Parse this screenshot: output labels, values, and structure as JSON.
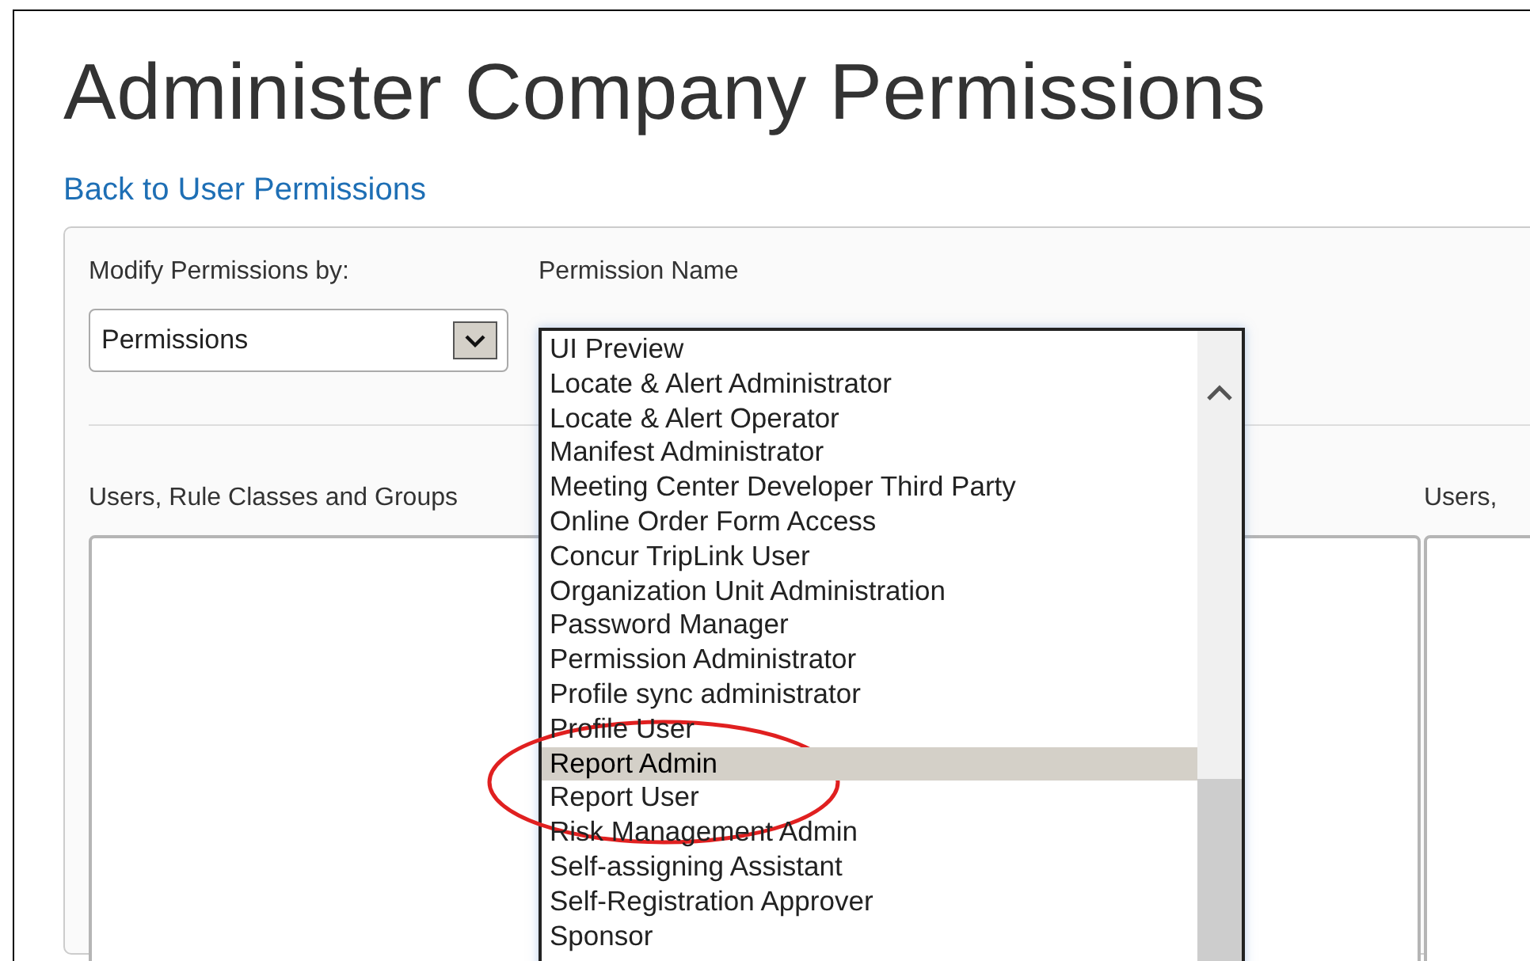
{
  "title": "Administer Company Permissions",
  "back_link": "Back to User Permissions",
  "filter": {
    "label": "Modify Permissions by:",
    "value": "Permissions"
  },
  "permission_name": {
    "label": "Permission Name",
    "options": [
      {
        "label": "UI Preview",
        "selected": false
      },
      {
        "label": "Locate & Alert Administrator",
        "selected": false
      },
      {
        "label": "Locate & Alert Operator",
        "selected": false
      },
      {
        "label": "Manifest Administrator",
        "selected": false
      },
      {
        "label": "Meeting Center Developer Third Party",
        "selected": false
      },
      {
        "label": "Online Order Form Access",
        "selected": false
      },
      {
        "label": "Concur TripLink User",
        "selected": false
      },
      {
        "label": "Organization Unit Administration",
        "selected": false
      },
      {
        "label": "Password Manager",
        "selected": false
      },
      {
        "label": "Permission Administrator",
        "selected": false
      },
      {
        "label": "Profile sync administrator",
        "selected": false
      },
      {
        "label": "Profile User",
        "selected": false
      },
      {
        "label": "Report Admin",
        "selected": true
      },
      {
        "label": "Report User",
        "selected": false
      },
      {
        "label": "Risk Management Admin",
        "selected": false
      },
      {
        "label": "Self-assigning Assistant",
        "selected": false
      },
      {
        "label": "Self-Registration Approver",
        "selected": false
      },
      {
        "label": "Sponsor",
        "selected": false
      }
    ]
  },
  "left_panel": {
    "label": "Users, Rule Classes and Groups"
  },
  "right_panel": {
    "label": "Users,"
  }
}
